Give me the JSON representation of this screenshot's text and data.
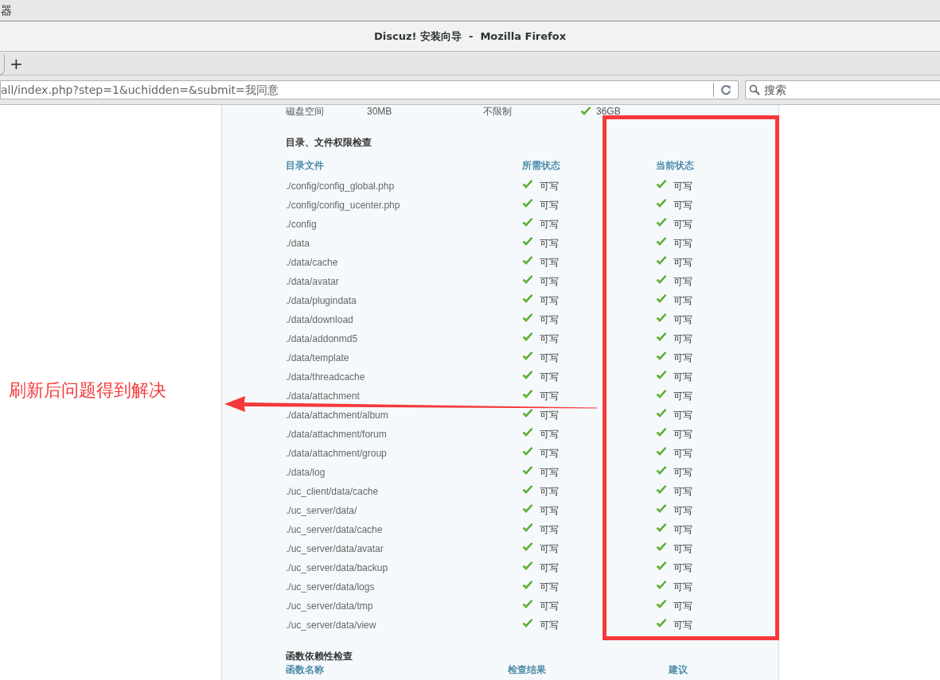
{
  "top_bar": {
    "title": "器"
  },
  "window": {
    "title": "Discuz! 安装向导  -  Mozilla Firefox"
  },
  "tab_bar": {
    "new_tab": "+"
  },
  "url_bar": {
    "value": "all/index.php?step=1&uchidden=&submit=我同意"
  },
  "search": {
    "placeholder": "搜索"
  },
  "env_row": {
    "cells": [
      "磁盘空间",
      "30MB",
      "不限制",
      "36GB"
    ]
  },
  "dir_section": {
    "title": "目录、文件权限检查",
    "columns": [
      "目录文件",
      "所需状态",
      "当前状态"
    ],
    "rows": [
      {
        "path": "./config/config_global.php",
        "required": "可写",
        "current": "可写"
      },
      {
        "path": "./config/config_ucenter.php",
        "required": "可写",
        "current": "可写"
      },
      {
        "path": "./config",
        "required": "可写",
        "current": "可写"
      },
      {
        "path": "./data",
        "required": "可写",
        "current": "可写"
      },
      {
        "path": "./data/cache",
        "required": "可写",
        "current": "可写"
      },
      {
        "path": "./data/avatar",
        "required": "可写",
        "current": "可写"
      },
      {
        "path": "./data/plugindata",
        "required": "可写",
        "current": "可写"
      },
      {
        "path": "./data/download",
        "required": "可写",
        "current": "可写"
      },
      {
        "path": "./data/addonmd5",
        "required": "可写",
        "current": "可写"
      },
      {
        "path": "./data/template",
        "required": "可写",
        "current": "可写"
      },
      {
        "path": "./data/threadcache",
        "required": "可写",
        "current": "可写"
      },
      {
        "path": "./data/attachment",
        "required": "可写",
        "current": "可写"
      },
      {
        "path": "./data/attachment/album",
        "required": "可写",
        "current": "可写"
      },
      {
        "path": "./data/attachment/forum",
        "required": "可写",
        "current": "可写"
      },
      {
        "path": "./data/attachment/group",
        "required": "可写",
        "current": "可写"
      },
      {
        "path": "./data/log",
        "required": "可写",
        "current": "可写"
      },
      {
        "path": "./uc_client/data/cache",
        "required": "可写",
        "current": "可写"
      },
      {
        "path": "./uc_server/data/",
        "required": "可写",
        "current": "可写"
      },
      {
        "path": "./uc_server/data/cache",
        "required": "可写",
        "current": "可写"
      },
      {
        "path": "./uc_server/data/avatar",
        "required": "可写",
        "current": "可写"
      },
      {
        "path": "./uc_server/data/backup",
        "required": "可写",
        "current": "可写"
      },
      {
        "path": "./uc_server/data/logs",
        "required": "可写",
        "current": "可写"
      },
      {
        "path": "./uc_server/data/tmp",
        "required": "可写",
        "current": "可写"
      },
      {
        "path": "./uc_server/data/view",
        "required": "可写",
        "current": "可写"
      }
    ]
  },
  "func_section": {
    "title": "函数依赖性检查",
    "columns": [
      "函数名称",
      "检查结果",
      "建议"
    ]
  },
  "annotation": {
    "text": "刷新后问题得到解决"
  }
}
